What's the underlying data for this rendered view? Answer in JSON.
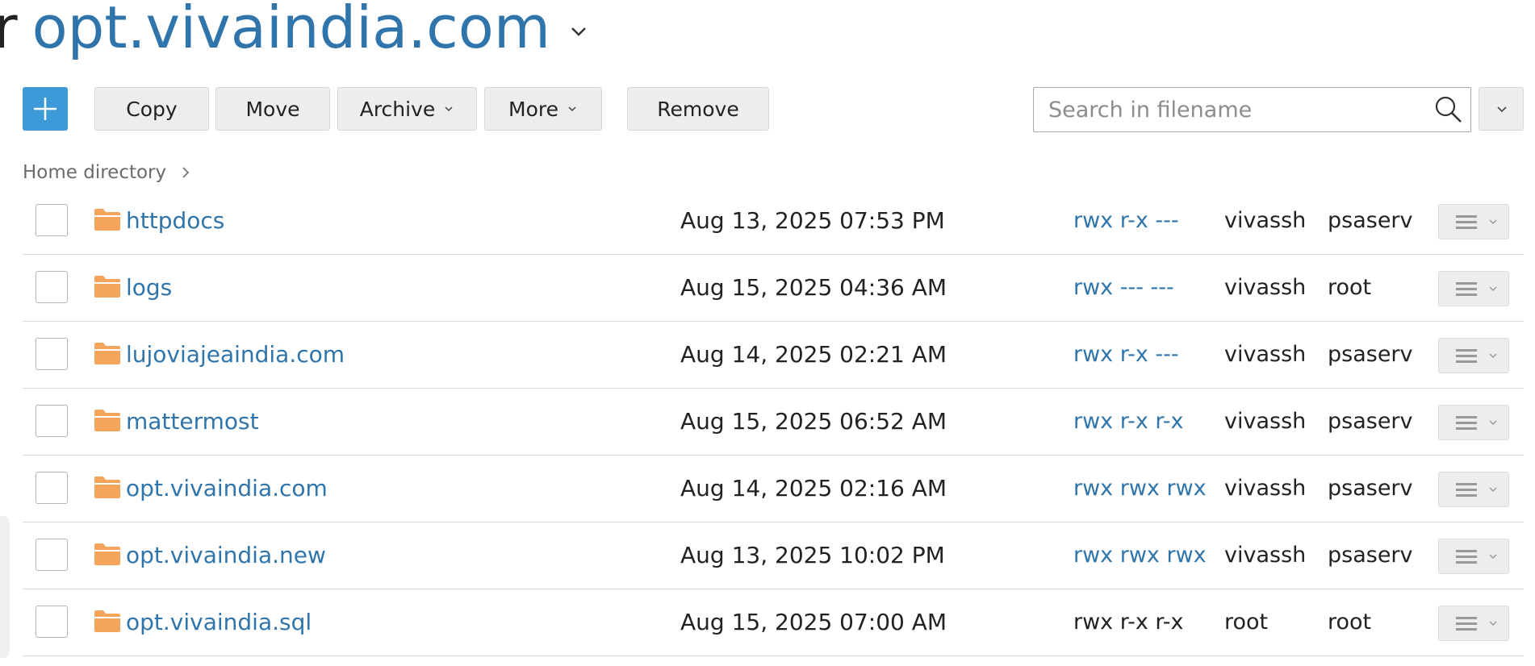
{
  "header": {
    "title_prefix": "r",
    "domain": "opt.vivaindia.com"
  },
  "toolbar": {
    "add_label": "+",
    "copy_label": "Copy",
    "move_label": "Move",
    "archive_label": "Archive",
    "more_label": "More",
    "remove_label": "Remove"
  },
  "search": {
    "placeholder": "Search in filename",
    "value": ""
  },
  "breadcrumb": {
    "home": "Home directory"
  },
  "colors": {
    "link": "#2f75ab",
    "add_button": "#3d9ad9",
    "folder": "#f5a55b"
  },
  "files": [
    {
      "name": "httpdocs",
      "modified": "Aug 13, 2025 07:53 PM",
      "permissions": "rwx r-x ---",
      "user": "vivassh",
      "group": "psaserv",
      "perm_is_link": true
    },
    {
      "name": "logs",
      "modified": "Aug 15, 2025 04:36 AM",
      "permissions": "rwx --- ---",
      "user": "vivassh",
      "group": "root",
      "perm_is_link": true
    },
    {
      "name": "lujoviajeaindia.com",
      "modified": "Aug 14, 2025 02:21 AM",
      "permissions": "rwx r-x ---",
      "user": "vivassh",
      "group": "psaserv",
      "perm_is_link": true
    },
    {
      "name": "mattermost",
      "modified": "Aug 15, 2025 06:52 AM",
      "permissions": "rwx r-x r-x",
      "user": "vivassh",
      "group": "psaserv",
      "perm_is_link": true
    },
    {
      "name": "opt.vivaindia.com",
      "modified": "Aug 14, 2025 02:16 AM",
      "permissions": "rwx rwx rwx",
      "user": "vivassh",
      "group": "psaserv",
      "perm_is_link": true
    },
    {
      "name": "opt.vivaindia.new",
      "modified": "Aug 13, 2025 10:02 PM",
      "permissions": "rwx rwx rwx",
      "user": "vivassh",
      "group": "psaserv",
      "perm_is_link": true
    },
    {
      "name": "opt.vivaindia.sql",
      "modified": "Aug 15, 2025 07:00 AM",
      "permissions": "rwx r-x r-x",
      "user": "root",
      "group": "root",
      "perm_is_link": false
    }
  ]
}
